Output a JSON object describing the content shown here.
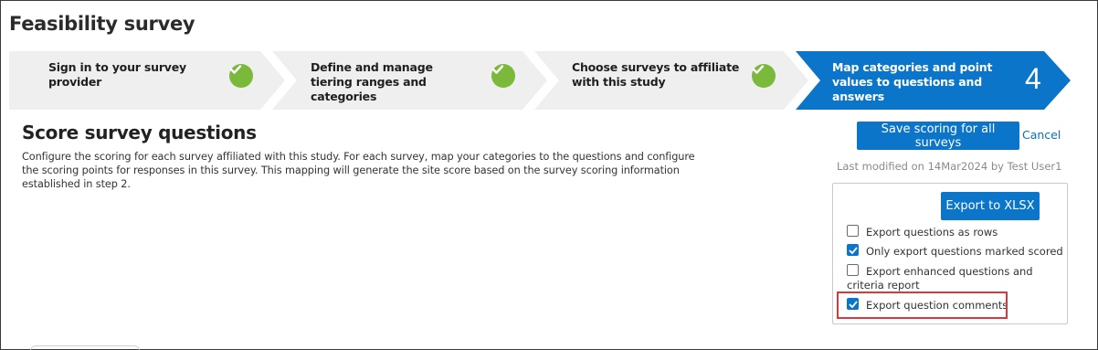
{
  "page": {
    "title": "Feasibility survey"
  },
  "stepper": {
    "steps": [
      {
        "label": "Sign in to your survey provider",
        "status": "complete"
      },
      {
        "label": "Define and manage tiering ranges and categories",
        "status": "complete"
      },
      {
        "label": "Choose surveys to affiliate with this study",
        "status": "complete"
      },
      {
        "label": "Map categories and point values to questions and answers",
        "status": "active",
        "number": "4"
      }
    ],
    "colors": {
      "inactive": "#efefef",
      "active": "#0b75c9",
      "check": "#7ab93a"
    }
  },
  "main": {
    "title": "Score survey questions",
    "description": "Configure the scoring for each survey affiliated with this study. For each survey, map your categories to the questions and configure the scoring points for responses in this survey. This mapping will generate the site score based on the survey scoring information established in step 2."
  },
  "actions": {
    "save_label": "Save scoring for all surveys",
    "cancel_label": "Cancel",
    "last_modified": "Last modified on 14Mar2024 by Test User1"
  },
  "export": {
    "button_label": "Export to XLSX",
    "options": [
      {
        "label": "Export questions as rows",
        "checked": false
      },
      {
        "label": "Only export questions marked scored",
        "checked": true
      },
      {
        "label": "Export enhanced questions and criteria report",
        "checked": false
      },
      {
        "label": "Export question comments",
        "checked": true,
        "highlighted": true
      }
    ],
    "highlight_color": "#d63a3a"
  }
}
